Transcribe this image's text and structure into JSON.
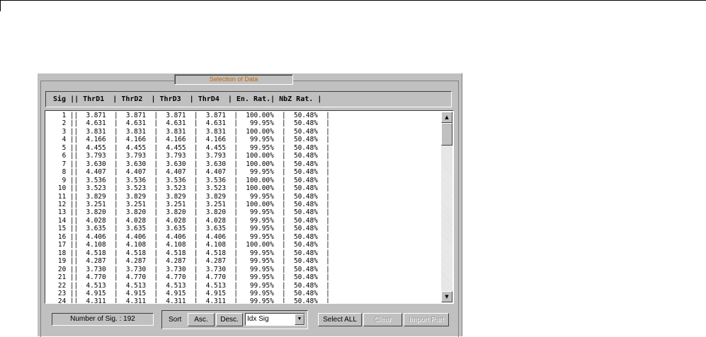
{
  "panel": {
    "title": "Selection of Data"
  },
  "table": {
    "header": "Sig || ThrD1  | ThrD2  | ThrD3  | ThrD4  | En. Rat.| NbZ Rat. |",
    "columns": [
      "Sig",
      "ThrD1",
      "ThrD2",
      "ThrD3",
      "ThrD4",
      "En. Rat.",
      "NbZ Rat."
    ],
    "rows": [
      "    1 ||  3.871  |  3.871  |  3.871  |  3.871  |  100.00%  |  50.48%  |",
      "    2 ||  4.631  |  4.631  |  4.631  |  4.631  |   99.95%  |  50.48%  |",
      "    3 ||  3.831  |  3.831  |  3.831  |  3.831  |  100.00%  |  50.48%  |",
      "    4 ||  4.166  |  4.166  |  4.166  |  4.166  |   99.95%  |  50.48%  |",
      "    5 ||  4.455  |  4.455  |  4.455  |  4.455  |   99.95%  |  50.48%  |",
      "    6 ||  3.793  |  3.793  |  3.793  |  3.793  |  100.00%  |  50.48%  |",
      "    7 ||  3.630  |  3.630  |  3.630  |  3.630  |  100.00%  |  50.48%  |",
      "    8 ||  4.407  |  4.407  |  4.407  |  4.407  |   99.95%  |  50.48%  |",
      "    9 ||  3.536  |  3.536  |  3.536  |  3.536  |  100.00%  |  50.48%  |",
      "   10 ||  3.523  |  3.523  |  3.523  |  3.523  |  100.00%  |  50.48%  |",
      "   11 ||  3.829  |  3.829  |  3.829  |  3.829  |   99.95%  |  50.48%  |",
      "   12 ||  3.251  |  3.251  |  3.251  |  3.251  |  100.00%  |  50.48%  |",
      "   13 ||  3.820  |  3.820  |  3.820  |  3.820  |   99.95%  |  50.48%  |",
      "   14 ||  4.028  |  4.028  |  4.028  |  4.028  |   99.95%  |  50.48%  |",
      "   15 ||  3.635  |  3.635  |  3.635  |  3.635  |   99.95%  |  50.48%  |",
      "   16 ||  4.406  |  4.406  |  4.406  |  4.406  |   99.95%  |  50.48%  |",
      "   17 ||  4.108  |  4.108  |  4.108  |  4.108  |  100.00%  |  50.48%  |",
      "   18 ||  4.518  |  4.518  |  4.518  |  4.518  |   99.95%  |  50.48%  |",
      "   19 ||  4.287  |  4.287  |  4.287  |  4.287  |   99.95%  |  50.48%  |",
      "   20 ||  3.730  |  3.730  |  3.730  |  3.730  |   99.95%  |  50.48%  |",
      "   21 ||  4.770  |  4.770  |  4.770  |  4.770  |   99.95%  |  50.48%  |",
      "   22 ||  4.513  |  4.513  |  4.513  |  4.513  |   99.95%  |  50.48%  |",
      "   23 ||  4.915  |  4.915  |  4.915  |  4.915  |   99.95%  |  50.48%  |",
      "   24 ||  4.311  |  4.311  |  4.311  |  4.311  |   99.95%  |  50.48%  |"
    ]
  },
  "footer": {
    "count_label": "Number of Sig. : 192",
    "sort_label": "Sort",
    "asc_label": "Asc.",
    "desc_label": "Desc.",
    "sort_select": "Idx Sig",
    "select_all_label": "Select ALL",
    "clear_label": "Clear",
    "import_label": "Import Part"
  },
  "colors": {
    "panel_bg": "#c0c0c0",
    "title_text": "#c36a00"
  }
}
